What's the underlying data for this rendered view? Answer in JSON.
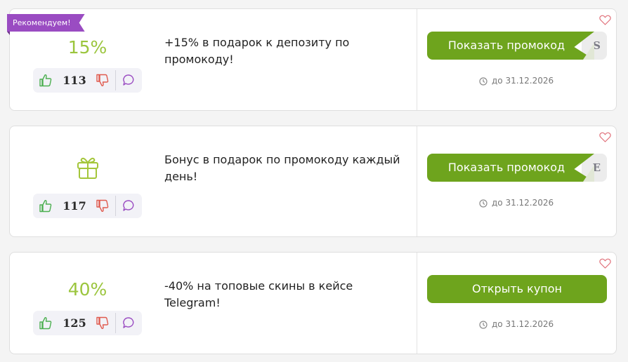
{
  "offers": [
    {
      "badge": "Рекомендуем!",
      "value": "15%",
      "votes": "113",
      "description": "+15% в подарок к депозиту по промокоду!",
      "button": "Показать промокод",
      "code_hint": "S",
      "expiry": "до 31.12.2026"
    },
    {
      "icon": "gift-icon",
      "votes": "117",
      "description": "Бонус в подарок по промокоду каждый день!",
      "button": "Показать промокод",
      "code_hint": "E",
      "expiry": "до 31.12.2026"
    },
    {
      "value": "40%",
      "votes": "125",
      "description": "-40% на топовые скины в кейсе Telegram!",
      "button": "Открыть купон",
      "expiry": "до 31.12.2026"
    }
  ],
  "colors": {
    "accent_green": "#6ea41d",
    "percent_green": "#9bc53d",
    "badge_purple": "#9a4cc2",
    "heart_red": "#e0707a"
  }
}
